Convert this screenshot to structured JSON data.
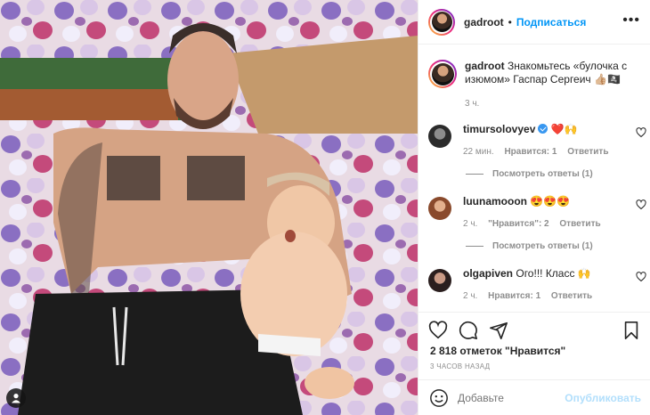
{
  "post": {
    "username": "gadroot",
    "separator": "•",
    "follow_label": "Подписаться",
    "more_label": "•••",
    "caption": {
      "username": "gadroot",
      "text": "Знакомьтесь «булочка с изюмом» Гаспар Сергеич 👍🏼🏴‍☠️",
      "time": "3 ч."
    }
  },
  "comments": [
    {
      "username": "timursolovyev",
      "verified": true,
      "text": "❤️🙌",
      "time": "22 мин.",
      "likes": "Нравится: 1",
      "reply": "Ответить",
      "view_replies": "Посмотреть ответы (1)"
    },
    {
      "username": "luunamooon",
      "verified": false,
      "text": "😍😍😍",
      "time": "2 ч.",
      "likes": "\"Нравится\": 2",
      "reply": "Ответить",
      "view_replies": "Посмотреть ответы (1)"
    },
    {
      "username": "olgapiven",
      "verified": false,
      "text": "Ого!!! Класс 🙌",
      "time": "2 ч.",
      "likes": "Нравится: 1",
      "reply": "Ответить"
    }
  ],
  "actions": {
    "icons": [
      "heart-icon",
      "comment-icon",
      "share-icon",
      "bookmark-icon"
    ],
    "likes_count": "2 818 отметок \"Нравится\"",
    "ago": "3 ЧАСОВ НАЗАД"
  },
  "add_comment": {
    "placeholder": "Добавьте",
    "publish_label": "Опубликовать"
  },
  "colors": {
    "link": "#0095f6",
    "muted": "#8e8e8e",
    "publish_disabled": "#b2dffc",
    "verified": "#3897f0"
  }
}
